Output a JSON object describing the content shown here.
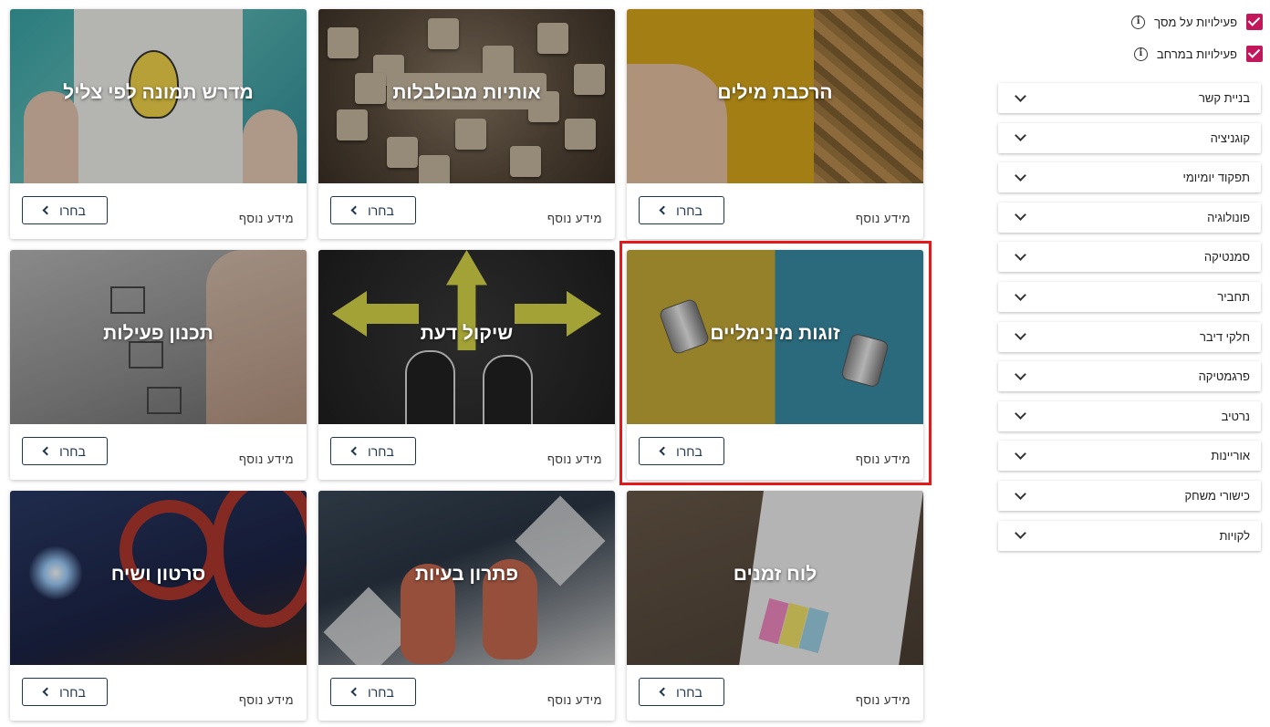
{
  "filters": [
    {
      "label": "פעילויות על מסך",
      "checked": true
    },
    {
      "label": "פעילויות במרחב",
      "checked": true
    }
  ],
  "categories": [
    "בניית קשר",
    "קוגניציה",
    "תפקוד יומיומי",
    "פונולוגיה",
    "סמנטיקה",
    "תחביר",
    "חלקי דיבר",
    "פרגמטיקה",
    "נרטיב",
    "אוריינות",
    "כישורי משחק",
    "לקויות"
  ],
  "common": {
    "more_info": "מידע נוסף",
    "choose": "בחרו"
  },
  "cards": [
    {
      "title": "הרכבת מילים",
      "image": "wooden-letters-hand"
    },
    {
      "title": "אותיות מבולבלות",
      "image": "wooden-cubes"
    },
    {
      "title": "מדרש תמונה לפי צליל",
      "image": "lightbulb-drawing"
    },
    {
      "title": "זוגות מינימליים",
      "image": "tin-can-phones"
    },
    {
      "title": "שיקול דעת",
      "image": "arrows-sneakers"
    },
    {
      "title": "תכנון פעילות",
      "image": "checklist-pen"
    },
    {
      "title": "לוח זמנים",
      "image": "calendar-notes"
    },
    {
      "title": "פתרון בעיות",
      "image": "sandals"
    },
    {
      "title": "סרטון ושיח",
      "image": "film-reels"
    }
  ],
  "colors": {
    "accent": "#c2185b",
    "button_border": "#1f3550",
    "highlight": "#e41a1a"
  }
}
